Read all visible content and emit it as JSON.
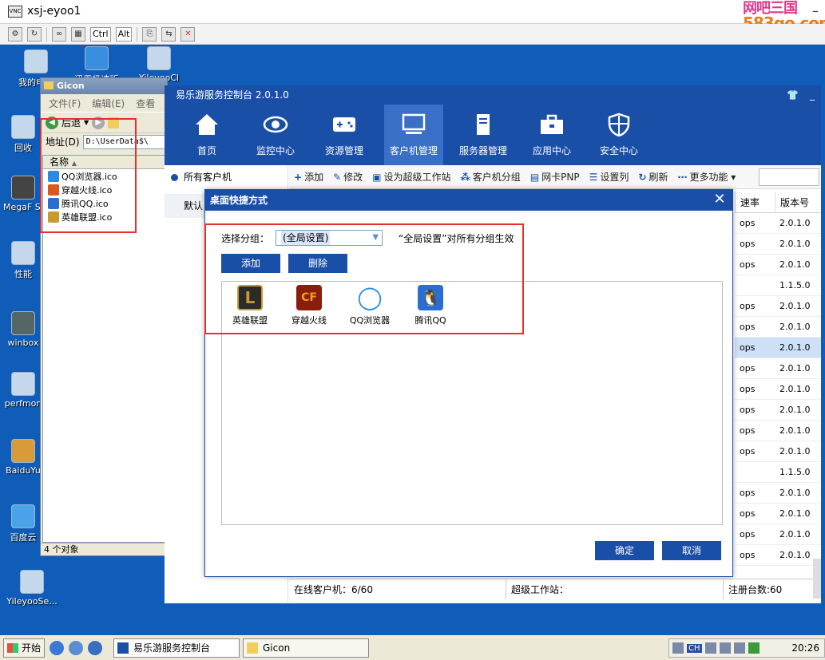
{
  "vnc": {
    "logo": "VNC",
    "title": "xsj-eyoo1",
    "brand_line1": "网吧三国",
    "brand_line2": "583go.com",
    "toolbar_ctrl": "Ctrl",
    "toolbar_alt": "Alt"
  },
  "desktop": {
    "icons": [
      {
        "label": "我的电脑"
      },
      {
        "label": "迅雷极速版"
      },
      {
        "label": "YileyooCl"
      },
      {
        "label": "回收"
      },
      {
        "label": "MegaF Stora"
      },
      {
        "label": "性能"
      },
      {
        "label": "winbox"
      },
      {
        "label": "perfmon"
      },
      {
        "label": "BaiduYu"
      },
      {
        "label": "百度云"
      },
      {
        "label": "YileyooSe..."
      }
    ]
  },
  "explorer": {
    "title": "Gicon",
    "menu": [
      "文件(F)",
      "编辑(E)",
      "查看"
    ],
    "back_label": "后退",
    "address_label": "地址(D)",
    "address_value": "D:\\UserData$\\",
    "column_name": "名称",
    "files": [
      {
        "name": "QQ浏览器.ico",
        "color": "#2a8be0"
      },
      {
        "name": "穿越火线.ico",
        "color": "#d9581b"
      },
      {
        "name": "腾讯QQ.ico",
        "color": "#2a6fd0"
      },
      {
        "name": "英雄联盟.ico",
        "color": "#c79b32"
      }
    ],
    "status": "4 个对象"
  },
  "console": {
    "title": "易乐游服务控制台 2.0.1.0",
    "nav": [
      {
        "label": "首页"
      },
      {
        "label": "监控中心"
      },
      {
        "label": "资源管理"
      },
      {
        "label": "客户机管理"
      },
      {
        "label": "服务器管理"
      },
      {
        "label": "应用中心"
      },
      {
        "label": "安全中心"
      }
    ],
    "sidebar": {
      "all_clients": "所有客户机",
      "default_group": "默认"
    },
    "toolbar": [
      {
        "icon": "+",
        "label": "添加"
      },
      {
        "icon": "✎",
        "label": "修改"
      },
      {
        "icon": "▣",
        "label": "设为超级工作站"
      },
      {
        "icon": "⁂",
        "label": "客户机分组"
      },
      {
        "icon": "▤",
        "label": "网卡PNP"
      },
      {
        "icon": "☰",
        "label": "设置列"
      },
      {
        "icon": "↻",
        "label": "刷新"
      },
      {
        "icon": "⋯",
        "label": "更多功能 ▾"
      }
    ],
    "grid": {
      "headers": [
        "速率",
        "版本号"
      ],
      "rows": [
        {
          "rate": "ops",
          "version": "2.0.1.0"
        },
        {
          "rate": "ops",
          "version": "2.0.1.0"
        },
        {
          "rate": "ops",
          "version": "2.0.1.0"
        },
        {
          "rate": "",
          "version": "1.1.5.0"
        },
        {
          "rate": "ops",
          "version": "2.0.1.0"
        },
        {
          "rate": "ops",
          "version": "2.0.1.0"
        },
        {
          "rate": "ops",
          "version": "2.0.1.0",
          "selected": true
        },
        {
          "rate": "ops",
          "version": "2.0.1.0"
        },
        {
          "rate": "ops",
          "version": "2.0.1.0"
        },
        {
          "rate": "ops",
          "version": "2.0.1.0"
        },
        {
          "rate": "ops",
          "version": "2.0.1.0"
        },
        {
          "rate": "ops",
          "version": "2.0.1.0"
        },
        {
          "rate": "",
          "version": "1.1.5.0"
        },
        {
          "rate": "ops",
          "version": "2.0.1.0"
        },
        {
          "rate": "ops",
          "version": "2.0.1.0"
        },
        {
          "rate": "ops",
          "version": "2.0.1.0"
        },
        {
          "rate": "ops",
          "version": "2.0.1.0"
        }
      ]
    },
    "status": {
      "online": "在线客户机：6/60",
      "super": "超级工作站：",
      "registered": "注册台数:60"
    }
  },
  "dialog": {
    "title": "桌面快捷方式",
    "close": "✕",
    "group_label": "选择分组：",
    "group_value": "(全局设置)",
    "hint": "“全局设置”对所有分组生效",
    "add_button": "添加",
    "delete_button": "删除",
    "icons": [
      {
        "label": "英雄联盟",
        "color": "#2b2b2b",
        "accent": "#c79b32",
        "glyph": "L"
      },
      {
        "label": "穿越火线",
        "color": "#8b1d0c",
        "accent": "#f0a020",
        "glyph": "CF"
      },
      {
        "label": "QQ浏览器",
        "color": "#ffffff",
        "accent": "#2a8be0",
        "glyph": "◯"
      },
      {
        "label": "腾讯QQ",
        "color": "#2a6fd0",
        "accent": "#111111",
        "glyph": "🐧"
      }
    ],
    "ok_button": "确定",
    "cancel_button": "取消"
  },
  "taskbar": {
    "start": "开始",
    "tasks": [
      {
        "label": "易乐游服务控制台"
      },
      {
        "label": "Gicon"
      }
    ],
    "tray_lang": "CH",
    "clock": "20:26"
  },
  "colors": {
    "accent": "#1a4fa8",
    "desktop": "#0f5db8",
    "highlight_box": "#e53030"
  }
}
